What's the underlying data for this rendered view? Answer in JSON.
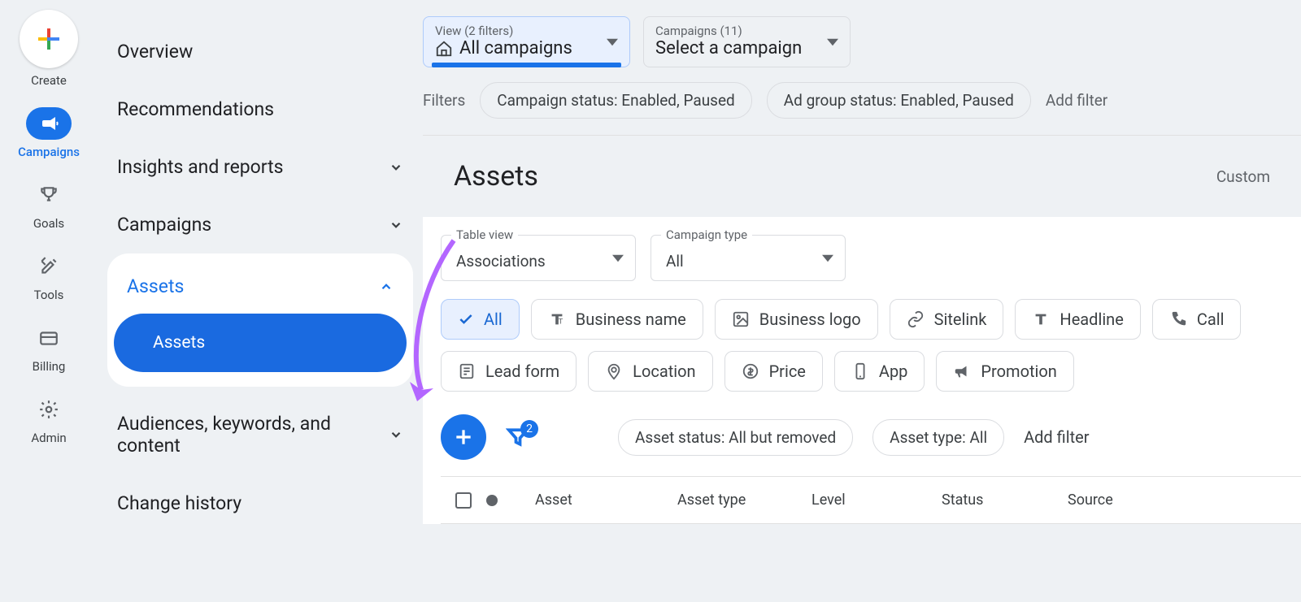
{
  "rail": {
    "create": "Create",
    "campaigns": "Campaigns",
    "goals": "Goals",
    "tools": "Tools",
    "billing": "Billing",
    "admin": "Admin"
  },
  "secnav": {
    "overview": "Overview",
    "recommendations": "Recommendations",
    "insights": "Insights and reports",
    "campaigns": "Campaigns",
    "assets_hdr": "Assets",
    "assets_sub": "Assets",
    "audiences": "Audiences, keywords, and content",
    "history": "Change history"
  },
  "selectors": {
    "view_small": "View (2 filters)",
    "view_big": "All campaigns",
    "camp_small": "Campaigns (11)",
    "camp_big": "Select a campaign"
  },
  "filters": {
    "label": "Filters",
    "chip1": "Campaign status: Enabled, Paused",
    "chip2": "Ad group status: Enabled, Paused",
    "add": "Add filter"
  },
  "page": {
    "title": "Assets",
    "custom": "Custom"
  },
  "dropdowns": {
    "tableview_lbl": "Table view",
    "tableview_val": "Associations",
    "camptype_lbl": "Campaign type",
    "camptype_val": "All"
  },
  "asset_types": {
    "all": "All",
    "business_name": "Business name",
    "business_logo": "Business logo",
    "sitelink": "Sitelink",
    "headline": "Headline",
    "call": "Call",
    "lead_form": "Lead form",
    "location": "Location",
    "price": "Price",
    "app": "App",
    "promotion": "Promotion"
  },
  "actions": {
    "badge": "2",
    "chip_status": "Asset status: All but removed",
    "chip_type": "Asset type: All",
    "add": "Add filter"
  },
  "table": {
    "asset": "Asset",
    "asset_type": "Asset type",
    "level": "Level",
    "status": "Status",
    "source": "Source"
  }
}
